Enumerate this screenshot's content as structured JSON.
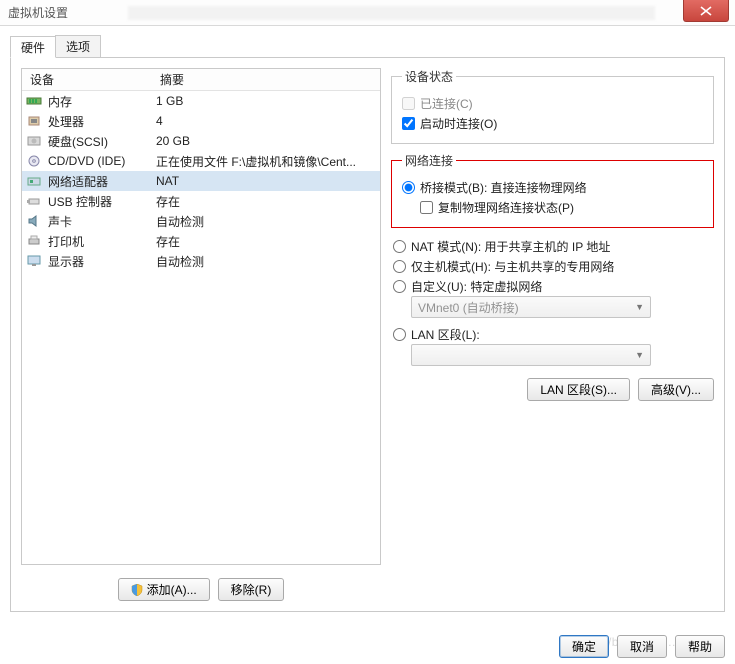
{
  "window": {
    "title": "虚拟机设置"
  },
  "tabs": {
    "hardware": "硬件",
    "options": "选项"
  },
  "hwlist": {
    "header_device": "设备",
    "header_summary": "摘要",
    "rows": [
      {
        "name": "内存",
        "summary": "1 GB",
        "icon": "memory"
      },
      {
        "name": "处理器",
        "summary": "4",
        "icon": "cpu"
      },
      {
        "name": "硬盘(SCSI)",
        "summary": "20 GB",
        "icon": "disk"
      },
      {
        "name": "CD/DVD (IDE)",
        "summary": "正在使用文件 F:\\虚拟机和镜像\\Cent...",
        "icon": "cd"
      },
      {
        "name": "网络适配器",
        "summary": "NAT",
        "icon": "nic",
        "selected": true
      },
      {
        "name": "USB 控制器",
        "summary": "存在",
        "icon": "usb"
      },
      {
        "name": "声卡",
        "summary": "自动检测",
        "icon": "sound"
      },
      {
        "name": "打印机",
        "summary": "存在",
        "icon": "printer"
      },
      {
        "name": "显示器",
        "summary": "自动检测",
        "icon": "display"
      }
    ],
    "add_btn": "添加(A)...",
    "remove_btn": "移除(R)"
  },
  "device_status": {
    "legend": "设备状态",
    "connected": "已连接(C)",
    "connected_checked": false,
    "connect_poweron": "启动时连接(O)",
    "connect_poweron_checked": true
  },
  "network": {
    "legend": "网络连接",
    "bridged": "桥接模式(B): 直接连接物理网络",
    "replicate": "复制物理网络连接状态(P)",
    "nat": "NAT 模式(N): 用于共享主机的 IP 地址",
    "hostonly": "仅主机模式(H): 与主机共享的专用网络",
    "custom": "自定义(U): 特定虚拟网络",
    "custom_value": "VMnet0 (自动桥接)",
    "lan": "LAN 区段(L):",
    "lan_value": "",
    "lan_btn": "LAN 区段(S)...",
    "adv_btn": "高级(V)..."
  },
  "footer": {
    "ok": "确定",
    "cancel": "取消",
    "help": "帮助"
  }
}
